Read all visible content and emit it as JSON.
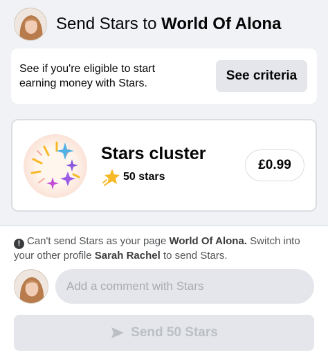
{
  "header": {
    "title_prefix": "Send Stars to ",
    "page_name": "World Of Alona"
  },
  "criteria": {
    "text": "See if you're eligible to start earning money with Stars.",
    "button_label": "See criteria"
  },
  "cluster": {
    "title": "Stars cluster",
    "count_label": "50 stars",
    "price": "£0.99"
  },
  "notice": {
    "part1": "Can't send Stars as your page ",
    "page_name": "World Of Alona.",
    "part2": " Switch into your other profile ",
    "profile_name": "Sarah Rachel",
    "part3": " to send Stars."
  },
  "comment": {
    "placeholder": "Add a comment with Stars"
  },
  "send": {
    "label": "Send 50 Stars"
  },
  "colors": {
    "background": "#f0f2f5",
    "button_gray": "#e4e6eb",
    "disabled_text": "#bcc0c4",
    "star_gold": "#f7b928"
  },
  "icons": {
    "star": "star-icon",
    "info": "info-icon",
    "send": "send-arrow-icon"
  }
}
